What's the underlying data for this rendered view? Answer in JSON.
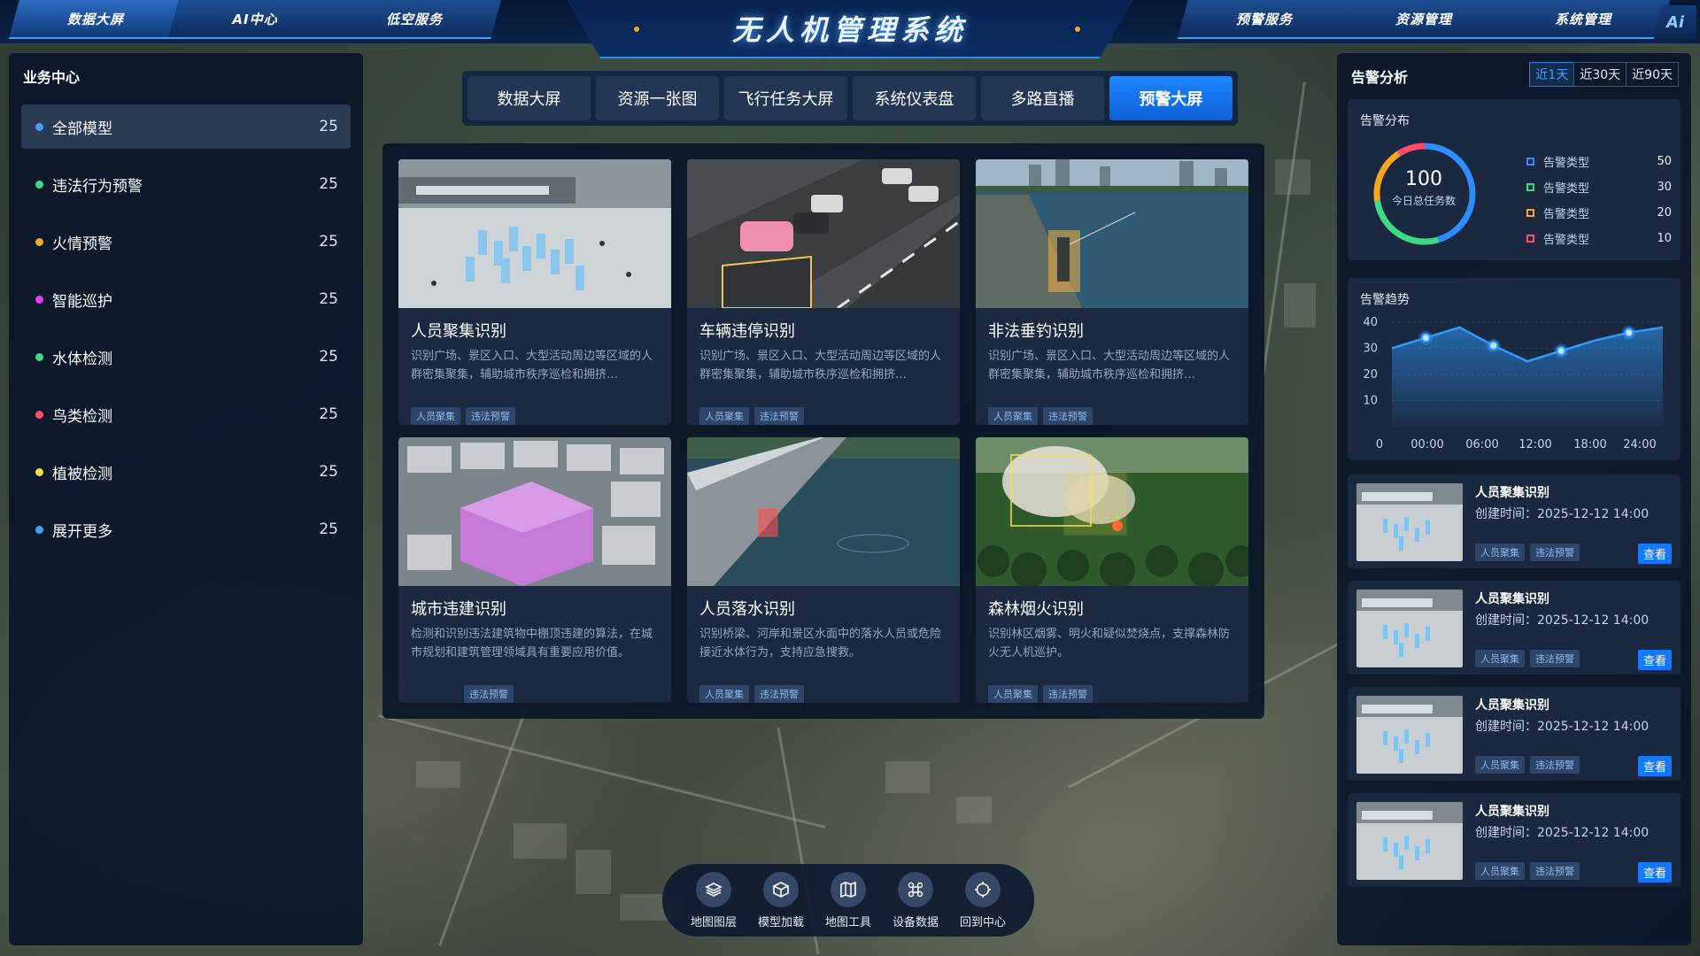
{
  "app": {
    "title": "无人机管理系统",
    "ai_badge": "Ai"
  },
  "nav_left": [
    "数据大屏",
    "AI中心",
    "低空服务"
  ],
  "nav_right": [
    "预警服务",
    "资源管理",
    "系统管理"
  ],
  "left_panel": {
    "title": "业务中心",
    "items": [
      {
        "label": "全部模型",
        "count": "25",
        "color": "#3ea0ff"
      },
      {
        "label": "违法行为预警",
        "count": "25",
        "color": "#3ddc84"
      },
      {
        "label": "火情预警",
        "count": "25",
        "color": "#f5a623"
      },
      {
        "label": "智能巡护",
        "count": "25",
        "color": "#e040fb"
      },
      {
        "label": "水体检测",
        "count": "25",
        "color": "#3ddc84"
      },
      {
        "label": "鸟类检测",
        "count": "25",
        "color": "#ff4d6d"
      },
      {
        "label": "植被检测",
        "count": "25",
        "color": "#f2e14c"
      },
      {
        "label": "展开更多",
        "count": "25",
        "color": "#3ea0ff"
      }
    ]
  },
  "center_tabs": [
    "数据大屏",
    "资源一张图",
    "飞行任务大屏",
    "系统仪表盘",
    "多路直播",
    "预警大屏"
  ],
  "cards": [
    {
      "title": "人员聚集识别",
      "desc": "识别广场、景区入口、大型活动周边等区域的人群密集聚集，辅助城市秩序巡检和拥挤…",
      "tags": [
        "人员聚集",
        "违法预警"
      ]
    },
    {
      "title": "车辆违停识别",
      "desc": "识别广场、景区入口、大型活动周边等区域的人群密集聚集，辅助城市秩序巡检和拥挤…",
      "tags": [
        "人员聚集",
        "违法预警"
      ]
    },
    {
      "title": "非法垂钓识别",
      "desc": "识别广场、景区入口、大型活动周边等区域的人群密集聚集，辅助城市秩序巡检和拥挤…",
      "tags": [
        "人员聚集",
        "违法预警"
      ]
    },
    {
      "title": "城市违建识别",
      "desc": "检测和识别违法建筑物中棚顶违建的算法，在城市规划和建筑管理领域具有重要应用价值。",
      "tags": [
        "违法预警"
      ]
    },
    {
      "title": "人员落水识别",
      "desc": "识别桥梁、河岸和景区水面中的落水人员或危险接近水体行为，支持应急搜救。",
      "tags": [
        "人员聚集",
        "违法预警"
      ]
    },
    {
      "title": "森林烟火识别",
      "desc": "识别林区烟雾、明火和疑似焚烧点，支撑森林防火无人机巡护。",
      "tags": [
        "人员聚集",
        "违法预警"
      ]
    }
  ],
  "bottom_tools": [
    {
      "label": "地图图层",
      "icon": "layers-icon"
    },
    {
      "label": "模型加载",
      "icon": "cube-icon"
    },
    {
      "label": "地图工具",
      "icon": "map-icon"
    },
    {
      "label": "设备数据",
      "icon": "command-icon"
    },
    {
      "label": "回到中心",
      "icon": "crosshair-icon"
    }
  ],
  "right_panel": {
    "title": "告警分析",
    "ranges": [
      "近1天",
      "近30天",
      "近90天"
    ],
    "distribution": {
      "title": "告警分布",
      "total": "100",
      "total_label": "今日总任务数",
      "items": [
        {
          "name": "告警类型",
          "value": 50,
          "color": "#2f8cff"
        },
        {
          "name": "告警类型",
          "value": 30,
          "color": "#3ddc84"
        },
        {
          "name": "告警类型",
          "value": 20,
          "color": "#f5a623"
        },
        {
          "name": "告警类型",
          "value": 10,
          "color": "#ff4d6d"
        }
      ]
    },
    "trend_title": "告警趋势",
    "alerts": [
      {
        "title": "人员聚集识别",
        "time": "创建时间：2025-12-12 14:00",
        "tags": [
          "人员聚集",
          "违法预警"
        ],
        "action": "查看"
      },
      {
        "title": "人员聚集识别",
        "time": "创建时间：2025-12-12 14:00",
        "tags": [
          "人员聚集",
          "违法预警"
        ],
        "action": "查看"
      },
      {
        "title": "人员聚集识别",
        "time": "创建时间：2025-12-12 14:00",
        "tags": [
          "人员聚集",
          "违法预警"
        ],
        "action": "查看"
      },
      {
        "title": "人员聚集识别",
        "time": "创建时间：2025-12-12 14:00",
        "tags": [
          "人员聚集",
          "违法预警"
        ],
        "action": "查看"
      }
    ]
  },
  "chart_data": {
    "type": "area",
    "title": "告警趋势",
    "x_ticks": [
      "0",
      "00:00",
      "06:00",
      "12:00",
      "18:00",
      "24:00"
    ],
    "y_ticks": [
      10,
      20,
      30,
      40
    ],
    "ylim": [
      0,
      42
    ],
    "x": [
      0,
      3,
      6,
      9,
      12,
      15,
      18,
      21,
      24
    ],
    "y": [
      30,
      34,
      38,
      31,
      25,
      29,
      33,
      36,
      38
    ],
    "markers_at": [
      3,
      9,
      15,
      21
    ],
    "color": "#2f9bff"
  }
}
